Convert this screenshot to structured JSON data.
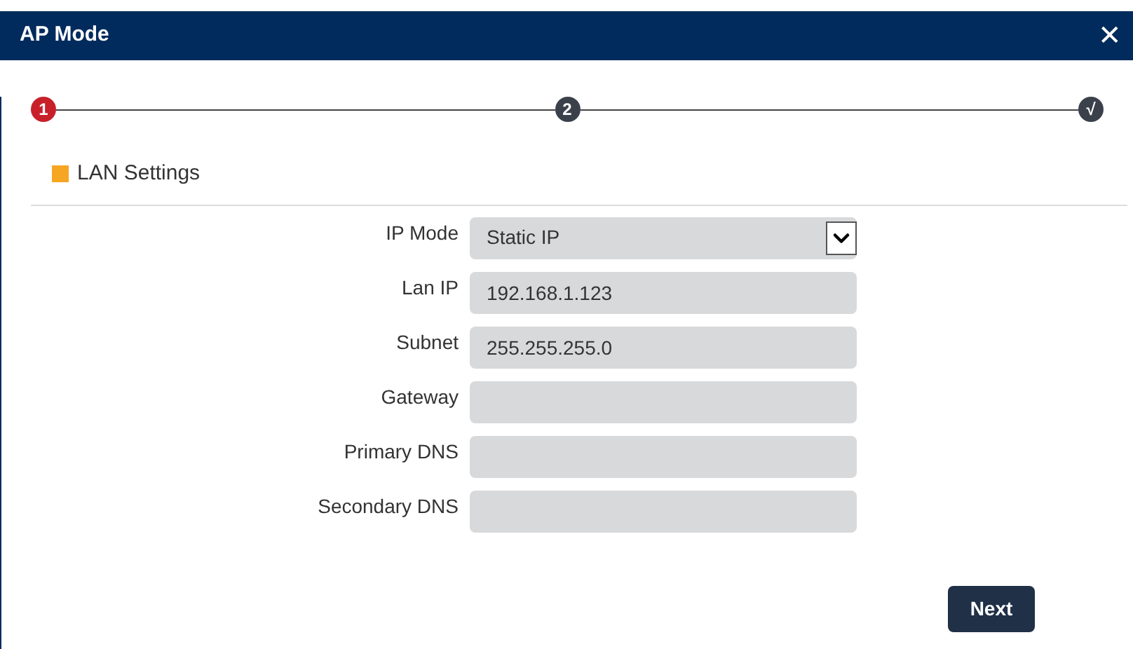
{
  "window": {
    "title": "AP Mode",
    "close": "✕"
  },
  "steps": [
    {
      "label": "1",
      "selected": true
    },
    {
      "label": "2",
      "selected": false
    },
    {
      "label": "√",
      "selected": false
    }
  ],
  "section": {
    "title": "LAN Settings"
  },
  "fields": [
    {
      "kind": "select",
      "label": "IP Mode",
      "value": "Static IP"
    },
    {
      "kind": "text",
      "label": "Lan IP",
      "value": "192.168.1.123"
    },
    {
      "kind": "text",
      "label": "Subnet",
      "value": "255.255.255.0"
    },
    {
      "kind": "text",
      "label": "Gateway"
    },
    {
      "kind": "text",
      "label": "Primary DNS"
    },
    {
      "kind": "text",
      "label": "Secondary DNS"
    }
  ],
  "buttons": [
    "Next"
  ]
}
